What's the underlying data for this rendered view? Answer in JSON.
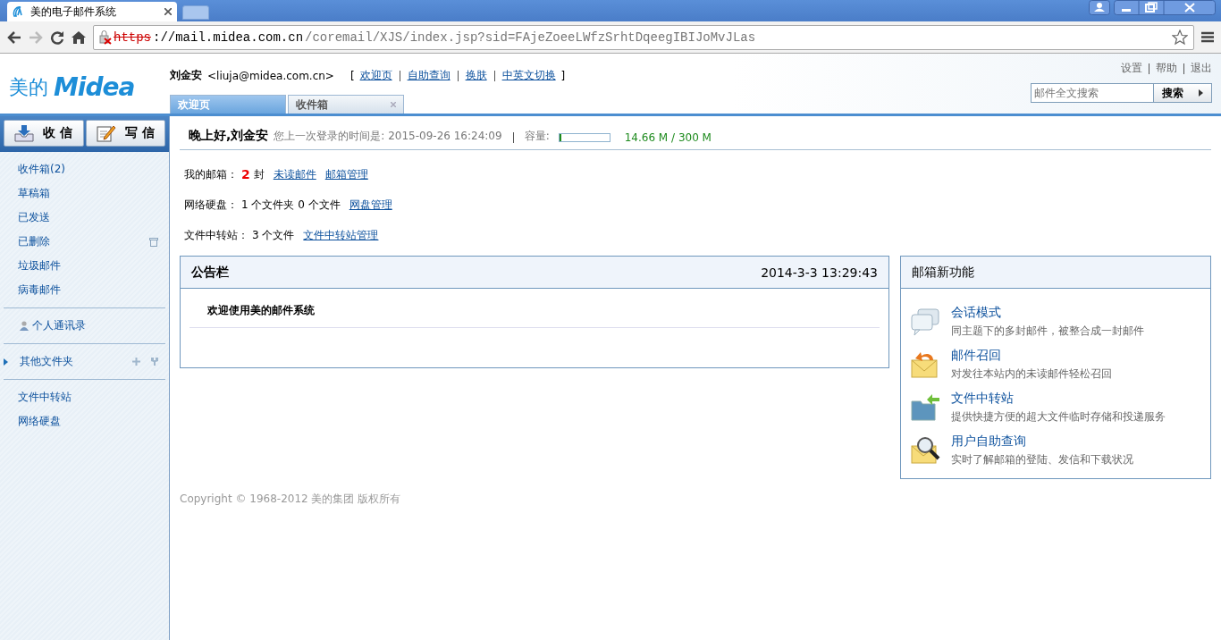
{
  "browser": {
    "tab_title": "美的电子邮件系统",
    "url": {
      "scheme": "https",
      "host": "://mail.midea.com.cn",
      "path": "/coremail/XJS/index.jsp?sid=FAjeZoeeLWfzSrhtDqeegIBIJoMvJLas"
    }
  },
  "logo": {
    "text": "美的",
    "brand": "Midea"
  },
  "user": {
    "name": "刘金安",
    "email": "<liuja@midea.com.cn>"
  },
  "top_links": [
    "欢迎页",
    "自助查询",
    "换肤",
    "中英文切换"
  ],
  "top_links_brackets": [
    "[",
    "]"
  ],
  "util_links": [
    "设置",
    "帮助",
    "退出"
  ],
  "search": {
    "placeholder": "邮件全文搜索",
    "button": "搜索"
  },
  "tabs": [
    {
      "label": "欢迎页",
      "selected": true,
      "closable": false
    },
    {
      "label": "收件箱",
      "selected": false,
      "closable": true
    }
  ],
  "sidebar": {
    "buttons": [
      {
        "label": "收 信",
        "kind": "receive"
      },
      {
        "label": "写 信",
        "kind": "compose"
      }
    ],
    "groups": [
      [
        {
          "label": "收件箱(2)",
          "kind": "folder"
        },
        {
          "label": "草稿箱",
          "kind": "folder"
        },
        {
          "label": "已发送",
          "kind": "folder"
        },
        {
          "label": "已删除",
          "kind": "trash"
        },
        {
          "label": "垃圾邮件",
          "kind": "folder"
        },
        {
          "label": "病毒邮件",
          "kind": "folder"
        }
      ],
      [
        {
          "label": "个人通讯录",
          "kind": "contacts"
        }
      ],
      [
        {
          "label": "其他文件夹",
          "kind": "group",
          "expanded": false
        }
      ],
      [
        {
          "label": "文件中转站",
          "kind": "folder"
        },
        {
          "label": "网络硬盘",
          "kind": "folder"
        }
      ]
    ]
  },
  "greeting": {
    "title": "晚上好,刘金安",
    "last_login": "您上一次登录的时间是: 2015-09-26 16:24:09",
    "capacity_label": "容量:",
    "level": 0.05,
    "capacity": "14.66 M / 300 M"
  },
  "info_rows": [
    {
      "label": "我的邮箱：",
      "count": "2",
      "text": "封",
      "links": [
        "未读邮件",
        "邮箱管理"
      ]
    },
    {
      "label": "网络硬盘：",
      "text": "1 个文件夹 0 个文件",
      "links": [
        "网盘管理"
      ]
    },
    {
      "label": "文件中转站：",
      "text": "3 个文件",
      "links": [
        "文件中转站管理"
      ]
    }
  ],
  "notice": {
    "title": "公告栏",
    "time": "2014-3-3 13:29:43",
    "items": [
      "欢迎使用美的邮件系统"
    ]
  },
  "features": {
    "title": "邮箱新功能",
    "items": [
      {
        "kind": "chat",
        "title": "会话模式",
        "desc": "同主题下的多封邮件，被整合成一封邮件"
      },
      {
        "kind": "recall",
        "title": "邮件召回",
        "desc": "对发往本站内的未读邮件轻松召回"
      },
      {
        "kind": "transfer",
        "title": "文件中转站",
        "desc": "提供快捷方便的超大文件临时存储和投递服务"
      },
      {
        "kind": "query",
        "title": "用户自助查询",
        "desc": "实时了解邮箱的登陆、发信和下载状况"
      }
    ]
  },
  "copyright": "Copyright © 1968-2012 美的集团 版权所有"
}
